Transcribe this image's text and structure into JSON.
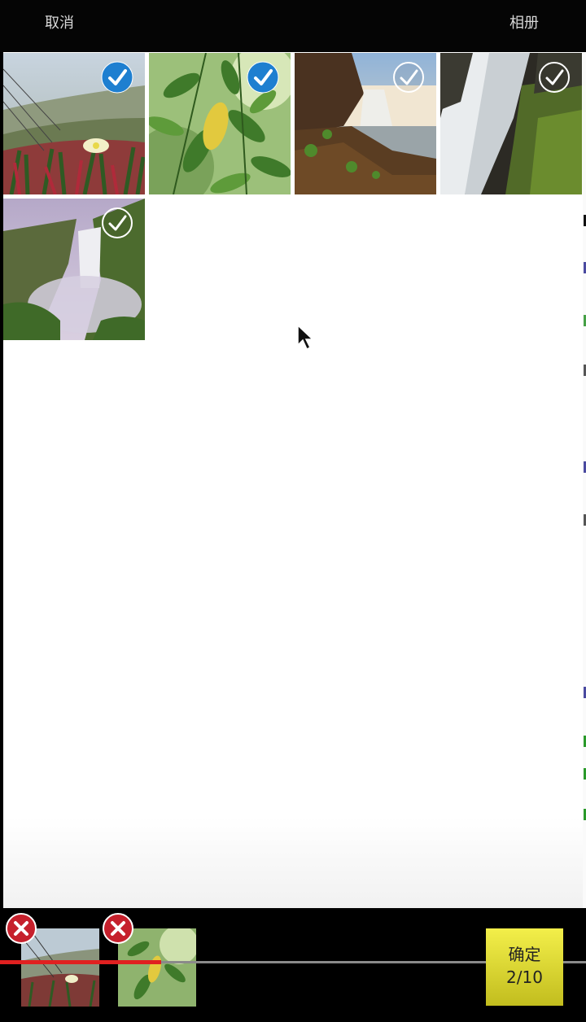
{
  "header": {
    "cancel_label": "取消",
    "album_label": "相册"
  },
  "grid": {
    "photos": [
      {
        "subject": "beach-ice-plant-flowers",
        "selected": true
      },
      {
        "subject": "green-leaves",
        "selected": true
      },
      {
        "subject": "waterfall-cliff",
        "selected": false
      },
      {
        "subject": "waterfall-rocks",
        "selected": false
      },
      {
        "subject": "waterfall-mist",
        "selected": false
      }
    ]
  },
  "selection": {
    "items": [
      {
        "subject": "beach-ice-plant-flowers"
      },
      {
        "subject": "green-leaves"
      }
    ],
    "progress": 0.275,
    "confirm_label": "确定",
    "count_label": "2/10"
  },
  "colors": {
    "check_selected": "#1e7fd0",
    "remove_badge": "#c6202c",
    "confirm_bg": "#e0dc36",
    "progress": "#e02020"
  },
  "icons": {
    "selected": "check-circle-filled-icon",
    "unselected": "check-circle-outline-icon",
    "remove": "close-circle-icon"
  }
}
